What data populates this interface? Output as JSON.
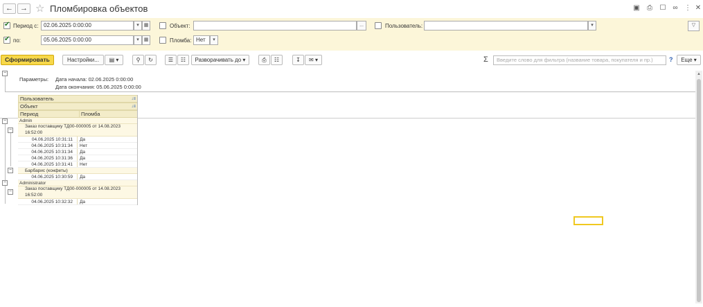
{
  "title": "Пломбировка объектов",
  "filters": {
    "period_from_label": "Период с:",
    "period_from_value": "02.06.2025  0:00:00",
    "period_to_label": "по:",
    "period_to_value": "05.06.2025  0:00:00",
    "object_label": "Объект:",
    "object_value": "",
    "object_btn": "...",
    "seal_label": "Пломба:",
    "seal_value": "Нет",
    "user_label": "Пользователь:",
    "user_value": ""
  },
  "toolbar": {
    "generate": "Сформировать",
    "settings": "Настройки...",
    "expand": "Разворачивать до",
    "search_placeholder": "Введите слово для фильтра (название товара, покупателя и пр.)",
    "help": "?",
    "more": "Еще"
  },
  "params": {
    "label": "Параметры:",
    "start": "Дата начала:  02.06.2025 0:00:00",
    "end": "Дата окончания:  05.06.2025 0:00:00"
  },
  "table": {
    "header_user": "Пользователь",
    "header_object": "Объект",
    "header_period": "Период",
    "header_seal": "Пломба",
    "groups": [
      {
        "user": "Admin",
        "objects": [
          {
            "name": "Заказ поставщику ТД00-000005 от 14.08.2023",
            "name2": "16:52:00",
            "rows": [
              {
                "period": "04.06.2025 10:31:11",
                "seal": "Да"
              },
              {
                "period": "04.06.2025 10:31:34",
                "seal": "Нет"
              },
              {
                "period": "04.06.2025 10:31:34",
                "seal": "Да"
              },
              {
                "period": "04.06.2025 10:31:36",
                "seal": "Да"
              },
              {
                "period": "04.06.2025 10:31:41",
                "seal": "Нет"
              }
            ]
          },
          {
            "name": "Барбарис (конфеты)",
            "rows": [
              {
                "period": "04.06.2025 10:30:59",
                "seal": "Да"
              }
            ]
          }
        ]
      },
      {
        "user": "Administrator",
        "objects": [
          {
            "name": "Заказ поставщику ТД00-000005 от 14.08.2023",
            "name2": "16:52:00",
            "rows": [
              {
                "period": "04.06.2025 10:32:32",
                "seal": "Да"
              }
            ]
          }
        ]
      }
    ]
  }
}
